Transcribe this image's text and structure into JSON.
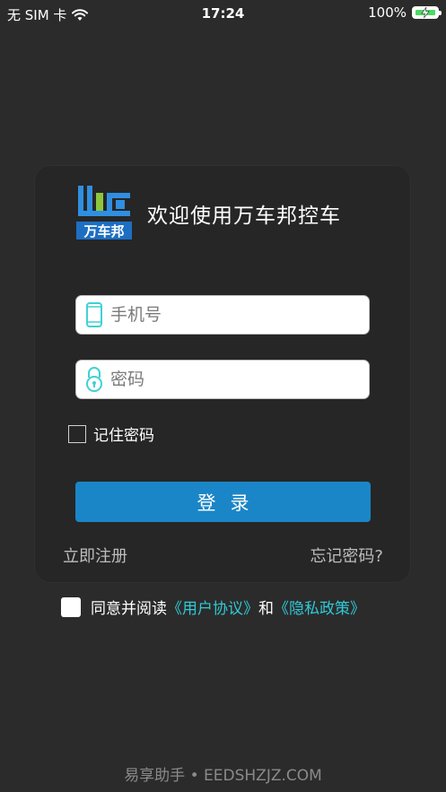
{
  "status_bar": {
    "carrier": "无 SIM 卡",
    "time": "17:24",
    "battery": "100%"
  },
  "header": {
    "logo_text": "万车邦",
    "welcome": "欢迎使用万车邦控车"
  },
  "form": {
    "phone_placeholder": "手机号",
    "password_placeholder": "密码",
    "remember_label": "记住密码",
    "login_label": "登录",
    "register_link": "立即注册",
    "forgot_link": "忘记密码?"
  },
  "agreement": {
    "prefix": "同意并阅读",
    "user_agreement": "《用户协议》",
    "and": "和",
    "privacy_policy": "《隐私政策》"
  },
  "watermark": "易享助手 • EEDSHZJZ.COM",
  "colors": {
    "background": "#2b2b2b",
    "card": "#262626",
    "primary_button": "#1a86c7",
    "link": "#2ecad6",
    "icon_accent": "#3fd1d6"
  }
}
